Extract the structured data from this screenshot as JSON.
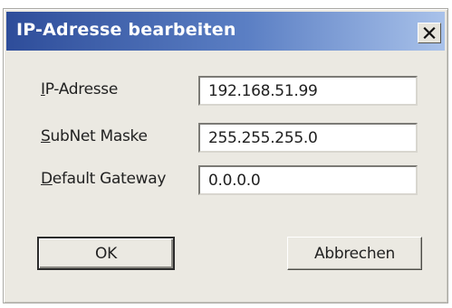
{
  "dialog": {
    "title": "IP-Adresse bearbeiten",
    "close_icon": "close-x-icon"
  },
  "fields": [
    {
      "label_mnemonic": "I",
      "label_rest": "P-Adresse",
      "value": "192.168.51.99"
    },
    {
      "label_mnemonic": "S",
      "label_rest": "ubNet Maske",
      "value": "255.255.255.0"
    },
    {
      "label_mnemonic": "D",
      "label_rest": "efault Gateway",
      "value": "0.0.0.0"
    }
  ],
  "buttons": {
    "ok_label": "OK",
    "cancel_label": "Abbrechen"
  },
  "colors": {
    "title_gradient_start": "#2e4d9a",
    "title_gradient_end": "#a9c2ea",
    "dialog_face": "#ebe9e2"
  }
}
